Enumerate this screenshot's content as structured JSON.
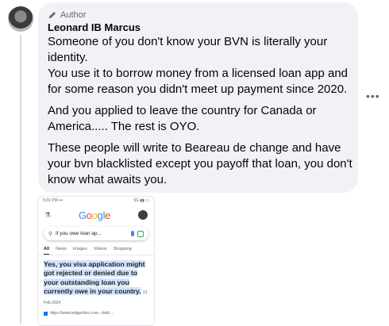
{
  "comment": {
    "badge": "Author",
    "author_name": "Leonard IB Marcus",
    "paragraphs": [
      "Someone of you don't know your BVN is literally your identity.",
      "You use it to borrow money from a licensed loan app and for some reason you didn't meet up payment since 2020.",
      "And you applied to leave the country for Canada or America..... The rest is OYO.",
      "These people will write to Beareau de change and have your bvn blacklisted except you payoff that loan, you don't know what awaits you."
    ],
    "more_icon": "•••"
  },
  "attachment": {
    "status_time": "5:01 PM ••• ",
    "status_icons": "5G ▮▮ ▭",
    "logo_letters": [
      "G",
      "o",
      "o",
      "g",
      "l",
      "e"
    ],
    "search_query": "if you owe loan ap...",
    "tabs": [
      "All",
      "News",
      "Images",
      "Videos",
      "Shopping"
    ],
    "snippet": "Yes, you visa application might got rejected or denied due to your outstanding loan you currently owe in your country.",
    "snippet_date": "21 Feb 2024",
    "source_url": "https://www.ledgerbloc.com › debt ..."
  },
  "colors": {
    "bubble": "#f0f2f5",
    "highlight": "#d3e3fd",
    "meta_text": "#65676b"
  }
}
